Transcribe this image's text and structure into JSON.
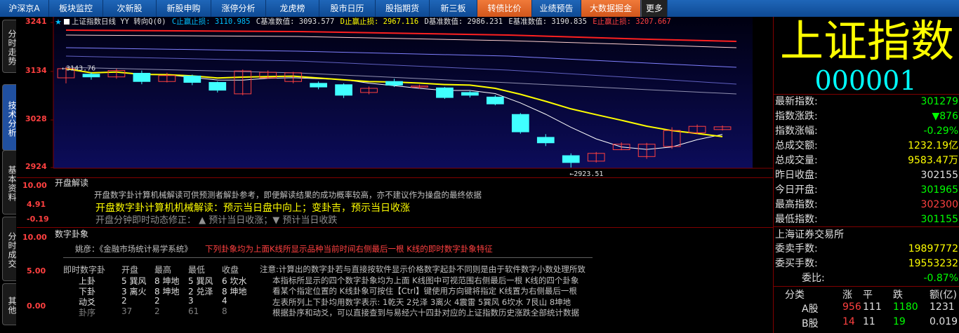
{
  "nav": {
    "tabs": [
      {
        "label": "沪深京A",
        "style": "normal"
      },
      {
        "label": "板块监控",
        "style": "normal"
      },
      {
        "label": "次新股",
        "style": "normal"
      },
      {
        "label": "新股申购",
        "style": "normal"
      },
      {
        "label": "涨停分析",
        "style": "normal"
      },
      {
        "label": "龙虎榜",
        "style": "normal"
      },
      {
        "label": "股市日历",
        "style": "normal"
      },
      {
        "label": "股指期货",
        "style": "normal"
      },
      {
        "label": "新三板",
        "style": "normal"
      },
      {
        "label": "转债比价",
        "style": "hl"
      },
      {
        "label": "业绩预告",
        "style": "normal"
      },
      {
        "label": "大数据掘金",
        "style": "hl"
      },
      {
        "label": "更多",
        "style": "more"
      }
    ]
  },
  "side_tabs": [
    "分时走势",
    "技术分析",
    "基本资料",
    "分时成交",
    "其他"
  ],
  "chart": {
    "legend": {
      "title": "上证指数日线 YY 转向Q(0)",
      "c_stop": "C止赢止损: 3110.985",
      "c_base": "C基准数值: 3093.577",
      "d_stop": "D止赢止损: 2967.116",
      "d_base": "D基准数值: 2986.231",
      "e_base": "E基准数值: 3190.835",
      "e_stop": "E止赢止损: 3207.667"
    },
    "y_ticks": [
      "3241",
      "3134",
      "3028",
      "2924"
    ],
    "high_label": "3143.76",
    "low_label": "2923.51"
  },
  "chart_data": {
    "type": "candlestick",
    "ylim": [
      2924,
      3241
    ],
    "candles": [
      {
        "o": 3120,
        "c": 3140,
        "h": 3144,
        "l": 3108
      },
      {
        "o": 3128,
        "c": 3122,
        "h": 3132,
        "l": 3116
      },
      {
        "o": 3122,
        "c": 3136,
        "h": 3140,
        "l": 3118
      },
      {
        "o": 3130,
        "c": 3112,
        "h": 3136,
        "l": 3106
      },
      {
        "o": 3112,
        "c": 3125,
        "h": 3131,
        "l": 3110
      },
      {
        "o": 3124,
        "c": 3110,
        "h": 3127,
        "l": 3104
      },
      {
        "o": 3110,
        "c": 3093,
        "h": 3112,
        "l": 3088
      },
      {
        "o": 3085,
        "c": 3135,
        "h": 3138,
        "l": 3082
      },
      {
        "o": 3120,
        "c": 3132,
        "h": 3136,
        "l": 3118
      },
      {
        "o": 3112,
        "c": 3131,
        "h": 3133,
        "l": 3108
      },
      {
        "o": 3108,
        "c": 3100,
        "h": 3112,
        "l": 3095
      },
      {
        "o": 3105,
        "c": 3082,
        "h": 3108,
        "l": 3076
      },
      {
        "o": 3088,
        "c": 3097,
        "h": 3101,
        "l": 3084
      },
      {
        "o": 3112,
        "c": 3104,
        "h": 3118,
        "l": 3100
      },
      {
        "o": 3100,
        "c": 3102,
        "h": 3105,
        "l": 3096
      },
      {
        "o": 3098,
        "c": 3077,
        "h": 3100,
        "l": 3074
      },
      {
        "o": 3088,
        "c": 3082,
        "h": 3091,
        "l": 3077
      },
      {
        "o": 3078,
        "c": 3063,
        "h": 3082,
        "l": 3060
      },
      {
        "o": 3040,
        "c": 3002,
        "h": 3043,
        "l": 2998
      },
      {
        "o": 2990,
        "c": 2978,
        "h": 2997,
        "l": 2971
      },
      {
        "o": 2950,
        "c": 2935,
        "h": 2955,
        "l": 2924
      },
      {
        "o": 2938,
        "c": 2955,
        "h": 2958,
        "l": 2935
      },
      {
        "o": 2963,
        "c": 2975,
        "h": 2979,
        "l": 2962
      },
      {
        "o": 2948,
        "c": 2975,
        "h": 2978,
        "l": 2943
      },
      {
        "o": 2970,
        "c": 3005,
        "h": 3012,
        "l": 2965
      },
      {
        "o": 3000,
        "c": 3014,
        "h": 3018,
        "l": 2997
      },
      {
        "o": 3007,
        "c": 3013,
        "h": 3016,
        "l": 3005
      }
    ]
  },
  "panel1": {
    "ticks": [
      "10.00",
      "4.91",
      "-0.19"
    ],
    "title": "开盘解读",
    "line1": "开盘数字卦计算机械解读可供预测者解卦参考，即便解读结果的成功概率较高，亦不建议作为操盘的最终依据",
    "line2": "开盘数字卦计算机机械解读：预示当日盘中向上；变卦吉，预示当日收涨",
    "line3": "开盘分钟即时动态修正：  ▲  预计当日收涨；▼  预计当日收跌"
  },
  "panel2": {
    "ticks": [
      "10.00",
      "5.00",
      "0.00"
    ],
    "title": "数字卦象",
    "cite": "姚彦：《金融市场统计易学系统》",
    "cite_red": "下列卦象均为上面K线所显示品种当前时间右侧最后一根 K线的即时数字卦象特征",
    "table_headers": [
      "即时数字卦",
      "开盘",
      "最高",
      "最低",
      "收盘"
    ],
    "table_rows": [
      [
        "上卦",
        "5 巽风",
        "8 坤地",
        "5 巽风",
        "6 坎水"
      ],
      [
        "下卦",
        "3 离火",
        "8 坤地",
        "2 兑泽",
        "8 坤地"
      ],
      [
        "动爻",
        "2",
        "2",
        "3",
        "4"
      ],
      [
        "卦序",
        "37",
        "2",
        "61",
        "8"
      ]
    ],
    "note_lines": [
      "注意:计算出的数字卦若与直接按软件显示价格数字起卦不同则是由于软件数字小数处理所致",
      "本指标所显示的四个数字卦象均为上面 K线图中可视范围右侧最后一根 K线的四个卦象",
      "看某个指定位置的 K线卦象可按住【Ctrl】键使用方向键将指定 K线置为右侧最后一根",
      "左表所列上下卦均用数字表示: 1乾天 2兑泽 3离火 4震雷 5巽风 6坎水 7艮山 8坤地",
      "根据卦序和动爻，可以直接查到与易经六十四卦对应的上证指数历史涨跌全部统计数据"
    ]
  },
  "right": {
    "name": "上证指数",
    "code": "000001",
    "quotes": [
      {
        "k": "最新指数:",
        "v": "301279",
        "c": "green"
      },
      {
        "k": "指数涨跌:",
        "v": "▼876",
        "c": "green"
      },
      {
        "k": "指数涨幅:",
        "v": "-0.29%",
        "c": "green"
      },
      {
        "k": "总成交额:",
        "v": "1232.19亿",
        "c": "yellow"
      },
      {
        "k": "总成交量:",
        "v": "9583.47万",
        "c": "yellow"
      },
      {
        "k": "昨日收盘:",
        "v": "302155",
        "c": "white"
      },
      {
        "k": "今日开盘:",
        "v": "301965",
        "c": "green"
      },
      {
        "k": "最高指数:",
        "v": "302300",
        "c": "red"
      },
      {
        "k": "最低指数:",
        "v": "301155",
        "c": "green"
      }
    ],
    "exchange": "上海证券交易所",
    "quotes2": [
      {
        "k": "委卖手数:",
        "v": "19897772",
        "c": "yellow"
      },
      {
        "k": "委买手数:",
        "v": "19553232",
        "c": "yellow"
      },
      {
        "k": "委比:",
        "v": "-0.87%",
        "c": "green"
      }
    ],
    "table_headers": [
      "分类",
      "涨",
      "平",
      "跌",
      "额(亿)"
    ],
    "table_rows": [
      [
        "A股",
        "956",
        "111",
        "1180",
        "1231"
      ],
      [
        "B股",
        "14",
        "11",
        "19",
        "0.019"
      ]
    ]
  }
}
